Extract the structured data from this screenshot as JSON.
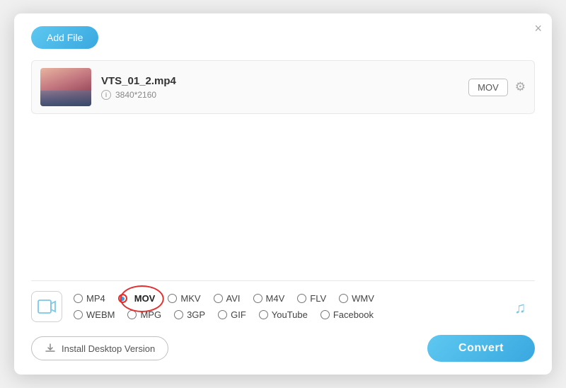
{
  "dialog": {
    "close_label": "×"
  },
  "header": {
    "add_file_label": "Add File"
  },
  "file": {
    "name": "VTS_01_2.mp4",
    "resolution": "3840*2160",
    "format_badge": "MOV"
  },
  "formats": {
    "row1": [
      {
        "id": "mp4",
        "label": "MP4",
        "selected": false
      },
      {
        "id": "mov",
        "label": "MOV",
        "selected": true
      },
      {
        "id": "mkv",
        "label": "MKV",
        "selected": false
      },
      {
        "id": "avi",
        "label": "AVI",
        "selected": false
      },
      {
        "id": "m4v",
        "label": "M4V",
        "selected": false
      },
      {
        "id": "flv",
        "label": "FLV",
        "selected": false
      },
      {
        "id": "wmv",
        "label": "WMV",
        "selected": false
      }
    ],
    "row2": [
      {
        "id": "webm",
        "label": "WEBM",
        "selected": false
      },
      {
        "id": "mpg",
        "label": "MPG",
        "selected": false
      },
      {
        "id": "3gp",
        "label": "3GP",
        "selected": false
      },
      {
        "id": "gif",
        "label": "GIF",
        "selected": false
      },
      {
        "id": "youtube",
        "label": "YouTube",
        "selected": false
      },
      {
        "id": "facebook",
        "label": "Facebook",
        "selected": false
      }
    ]
  },
  "footer": {
    "install_label": "Install Desktop Version",
    "convert_label": "Convert"
  }
}
